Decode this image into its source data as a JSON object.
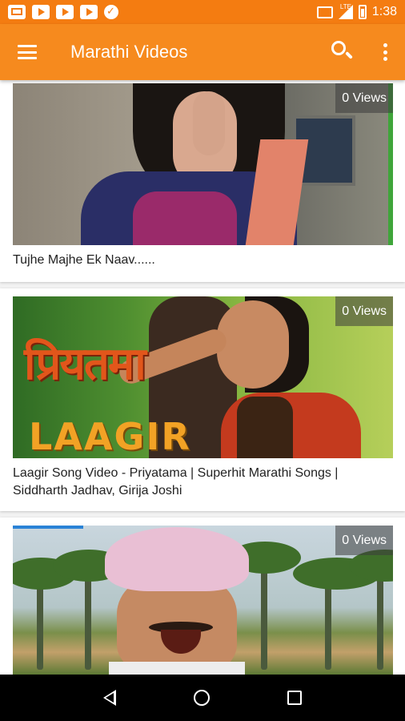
{
  "status_bar": {
    "time": "1:38",
    "network_label": "LTE",
    "left_icons": [
      "mail-icon",
      "youtube-icon",
      "youtube-icon",
      "youtube-icon",
      "check-icon"
    ],
    "right_icons": [
      "cast-icon",
      "signal-icon",
      "battery-icon"
    ]
  },
  "app_bar": {
    "title": "Marathi Videos",
    "accent_color": "#f68a1e",
    "icons": [
      "menu-icon",
      "search-icon",
      "more-vert-icon"
    ]
  },
  "videos": [
    {
      "title": "Tujhe Majhe Ek Naav......",
      "views": "0 Views"
    },
    {
      "title": "Laagir Song Video - Priyatama | Superhit Marathi Songs | Siddharth Jadhav, Girija Joshi",
      "views": "0 Views",
      "thumbnail_text": [
        "प्रियतमा",
        "LAAGIR"
      ]
    },
    {
      "title": "",
      "views": "0 Views"
    }
  ],
  "nav_bar": {
    "icons": [
      "back-icon",
      "home-icon",
      "recents-icon"
    ]
  }
}
